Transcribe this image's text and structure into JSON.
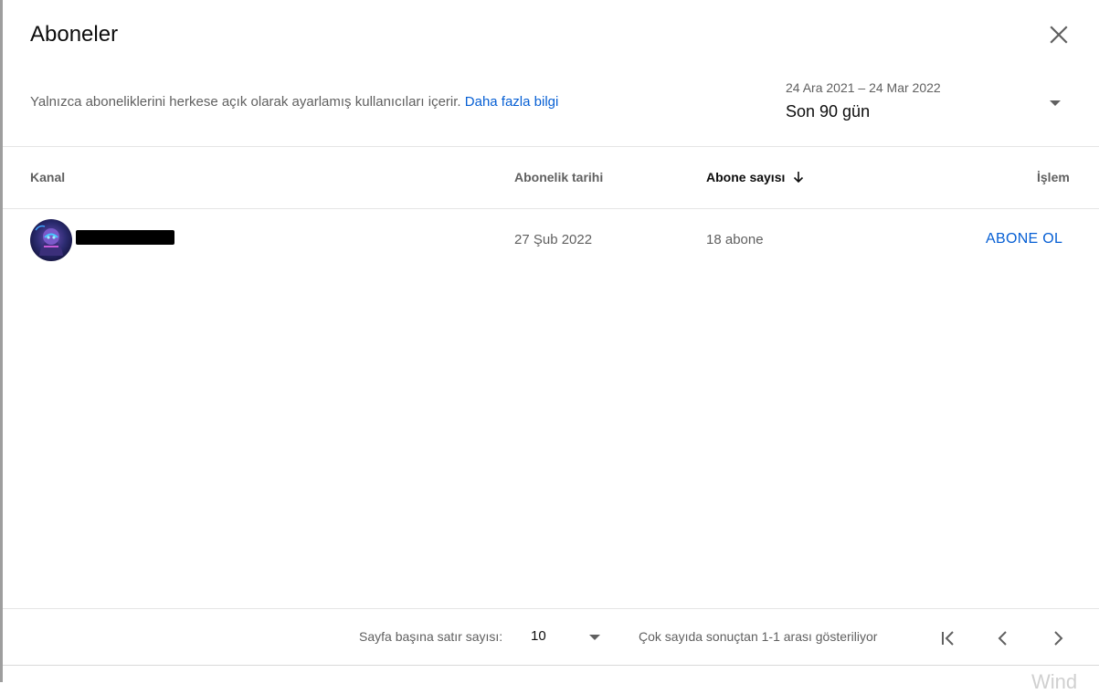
{
  "dialog": {
    "title": "Aboneler",
    "subtitle": "Yalnızca aboneliklerini herkese açık olarak ayarlamış kullanıcıları içerir.",
    "learn_more": "Daha fazla bilgi"
  },
  "date_filter": {
    "range": "24 Ara 2021 – 24 Mar 2022",
    "preset": "Son 90 gün"
  },
  "table": {
    "columns": {
      "channel": "Kanal",
      "subscription_date": "Abonelik tarihi",
      "subscriber_count": "Abone sayısı",
      "action": "İşlem"
    },
    "rows": [
      {
        "subscription_date": "27 Şub 2022",
        "subscriber_count": "18 abone",
        "action_label": "ABONE OL"
      }
    ]
  },
  "pagination": {
    "rows_per_page_label": "Sayfa başına satır sayısı:",
    "rows_per_page_value": "10",
    "range_text": "Çok sayıda sonuçtan 1-1 arası gösteriliyor"
  },
  "watermark": "Wind",
  "icons": {
    "close": "close-icon",
    "dropdown": "caret-down-icon",
    "sort": "arrow-down-icon",
    "first_page": "first-page-icon",
    "prev_page": "chevron-left-icon",
    "next_page": "chevron-right-icon"
  },
  "colors": {
    "link": "#065fd4",
    "text_primary": "#0d0d0d",
    "text_secondary": "#606060",
    "divider": "#e5e5e5"
  }
}
